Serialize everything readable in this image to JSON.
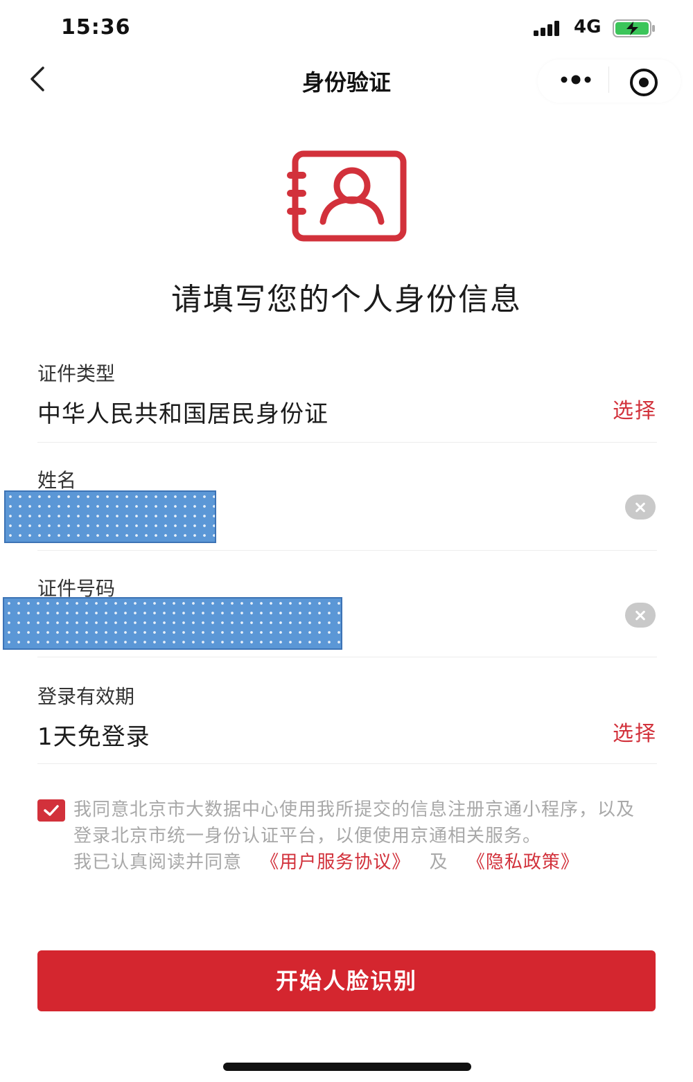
{
  "status_bar": {
    "time": "15:36",
    "network": "4G",
    "signal_icon": "cellular-signal-icon",
    "battery_icon": "battery-charging-icon"
  },
  "nav": {
    "back_icon": "chevron-left-icon",
    "title": "身份验证",
    "more_icon": "more-dots-icon",
    "close_icon": "target-circle-icon"
  },
  "hero": {
    "icon": "id-card-person-icon",
    "heading": "请填写您的个人身份信息"
  },
  "form": {
    "doc_type": {
      "label": "证件类型",
      "value": "中华人民共和国居民身份证",
      "action": "选择"
    },
    "name": {
      "label": "姓名",
      "value_state": "redacted",
      "clear_icon": "clear-circle-icon"
    },
    "id_number": {
      "label": "证件号码",
      "value_state": "redacted",
      "clear_icon": "clear-circle-icon"
    },
    "validity": {
      "label": "登录有效期",
      "value": "1天免登录",
      "action": "选择"
    }
  },
  "agreement": {
    "checked": true,
    "checkbox_icon": "checkmark-icon",
    "text": "我同意北京市大数据中心使用我所提交的信息注册京通小程序，以及登录北京市统一身份认证平台，以便使用京通相关服务。",
    "read_prefix": "我已认真阅读并同意",
    "link_terms": "《用户服务协议》",
    "conj": "及",
    "link_privacy": "《隐私政策》"
  },
  "actions": {
    "start_button": "开始人脸识别"
  },
  "colors": {
    "accent": "#d2313b",
    "button": "#d4262f",
    "muted_text": "#a8a8a8"
  }
}
